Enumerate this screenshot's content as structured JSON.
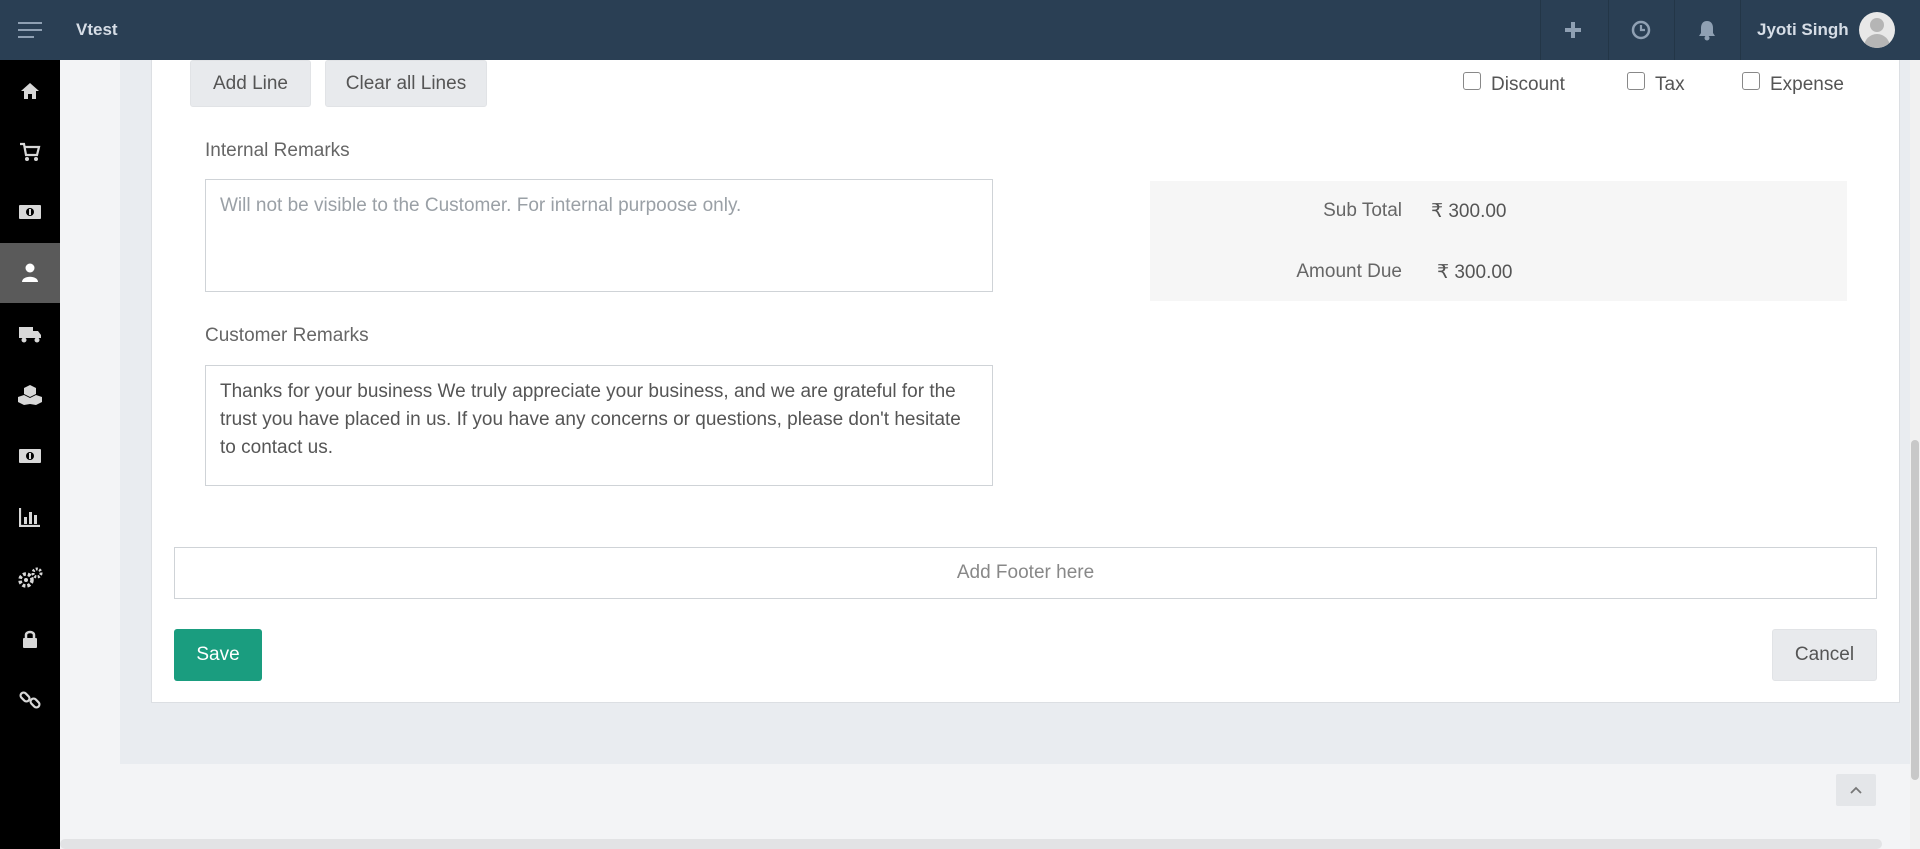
{
  "header": {
    "brand": "Vtest",
    "user_name": "Jyoti Singh",
    "icons": [
      "menu-icon",
      "plus-icon",
      "clock-icon",
      "bell-icon"
    ]
  },
  "sidebar": {
    "items": [
      {
        "icon": "home-icon"
      },
      {
        "icon": "cart-icon"
      },
      {
        "icon": "money-icon"
      },
      {
        "icon": "user-icon",
        "active": true
      },
      {
        "icon": "truck-icon"
      },
      {
        "icon": "boxes-icon"
      },
      {
        "icon": "money-icon"
      },
      {
        "icon": "chart-icon"
      },
      {
        "icon": "gears-icon"
      },
      {
        "icon": "lock-icon"
      },
      {
        "icon": "link-icon"
      }
    ]
  },
  "lines": {
    "add_line_label": "Add Line",
    "clear_lines_label": "Clear all Lines"
  },
  "options": {
    "discount_label": "Discount",
    "tax_label": "Tax",
    "expense_label": "Expense"
  },
  "internal_remarks": {
    "label": "Internal Remarks",
    "placeholder": "Will not be visible to the Customer. For internal purpoose only.",
    "value": ""
  },
  "customer_remarks": {
    "label": "Customer Remarks",
    "value": "Thanks for your business We truly appreciate your business, and we are grateful for the trust you have placed in us. If you have any concerns or questions, please don't hesitate to contact us."
  },
  "totals": {
    "sub_total_label": "Sub Total",
    "sub_total_value": "₹ 300.00",
    "amount_due_label": "Amount Due",
    "amount_due_value": "₹ 300.00"
  },
  "footer": {
    "placeholder": "Add Footer here"
  },
  "actions": {
    "save_label": "Save",
    "cancel_label": "Cancel"
  },
  "colors": {
    "topbar": "#2a3f54",
    "sidebar": "#000000",
    "save_button": "#1a9d7f"
  }
}
